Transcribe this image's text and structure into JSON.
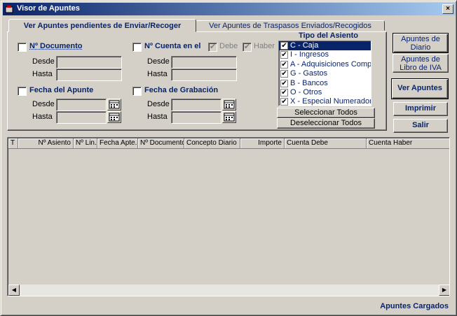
{
  "window": {
    "title": "Visor de Apuntes",
    "close": "×"
  },
  "tabs": [
    {
      "label": "Ver Apuntes pendientes de Enviar/Recoger"
    },
    {
      "label": "Ver Apuntes de Traspasos Enviados/Recogidos"
    }
  ],
  "filters": {
    "documento": {
      "label": "Nº Documento",
      "desde": "Desde",
      "hasta": "Hasta"
    },
    "cuenta": {
      "label": "Nº Cuenta en el",
      "debe": "Debe",
      "haber": "Haber",
      "desde": "Desde",
      "hasta": "Hasta"
    },
    "fecha_apunte": {
      "label": "Fecha del Apunte",
      "desde": "Desde",
      "hasta": "Hasta"
    },
    "fecha_grabacion": {
      "label": "Fecha de Grabación",
      "desde": "Desde",
      "hasta": "Hasta"
    }
  },
  "tipo_asiento": {
    "title": "Tipo del Asiento",
    "items": [
      {
        "label": "C - Caja",
        "checked": true
      },
      {
        "label": "I - Ingresos",
        "checked": true
      },
      {
        "label": "A - Adquisiciones Compras",
        "checked": true
      },
      {
        "label": "G - Gastos",
        "checked": true
      },
      {
        "label": "B - Bancos",
        "checked": true
      },
      {
        "label": "O - Otros",
        "checked": true
      },
      {
        "label": "X - Especial Numeradores",
        "checked": true
      }
    ],
    "select_all": "Seleccionar Todos",
    "deselect_all": "Deseleccionar Todos"
  },
  "buttons": {
    "diario": "Apuntes de Diario",
    "iva": "Apuntes de Libro de IVA",
    "ver": "Ver Apuntes",
    "imprimir": "Imprimir",
    "salir": "Salir"
  },
  "grid": {
    "columns": [
      "T",
      "Nº Asiento",
      "Nº Lin.",
      "Fecha Apte.",
      "Nº Documento",
      "Concepto Diario",
      "Importe",
      "Cuenta Debe",
      "Cuenta Haber"
    ]
  },
  "status": "Apuntes Cargados"
}
